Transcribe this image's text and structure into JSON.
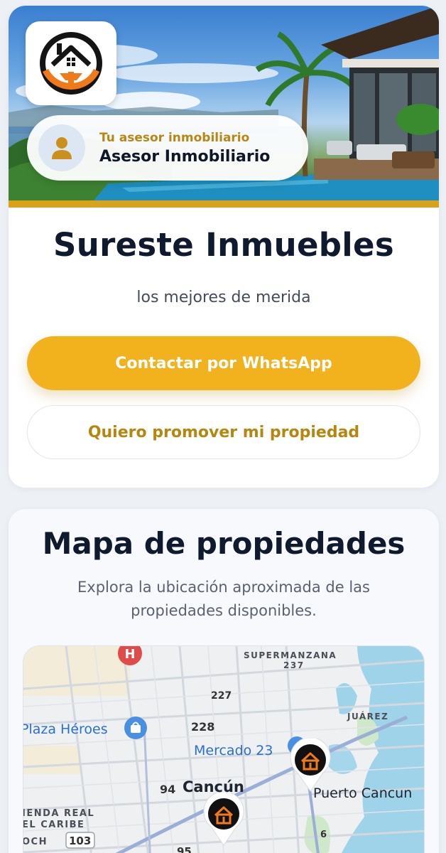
{
  "hero": {
    "advisor_subtitle": "Tu asesor inmobiliario",
    "advisor_name": "Asesor Inmobiliario",
    "brand_title": "Sureste Inmuebles",
    "brand_tagline": "los mejores de merida",
    "whatsapp_button": "Contactar por WhatsApp",
    "promote_button": "Quiero promover mi propiedad"
  },
  "map_section": {
    "title": "Mapa de propiedades",
    "description": "Explora la ubicación aproximada de las propiedades disponibles.",
    "map_labels": {
      "supermanzana": "SUPERMANZANA",
      "sm_237": "237",
      "n_227": "227",
      "n_228": "228",
      "juarez": "JUÁREZ",
      "plaza_heroes": "Plaza Héroes",
      "mercado_23": "Mercado 23",
      "n_94": "94",
      "cancun": "Cancún",
      "puerto_cancun": "Puerto Cancun",
      "hacienda_real": "IENDA REAL",
      "el_caribe": "EL CARIBE",
      "och": "OCH",
      "n_103": "103",
      "n_95": "95",
      "n_6": "6",
      "hospital_letter": "H"
    }
  },
  "colors": {
    "accent": "#f2b21d",
    "gold_text": "#b7860f",
    "title": "#0f1a2e",
    "logo_orange": "#f07a1a"
  }
}
